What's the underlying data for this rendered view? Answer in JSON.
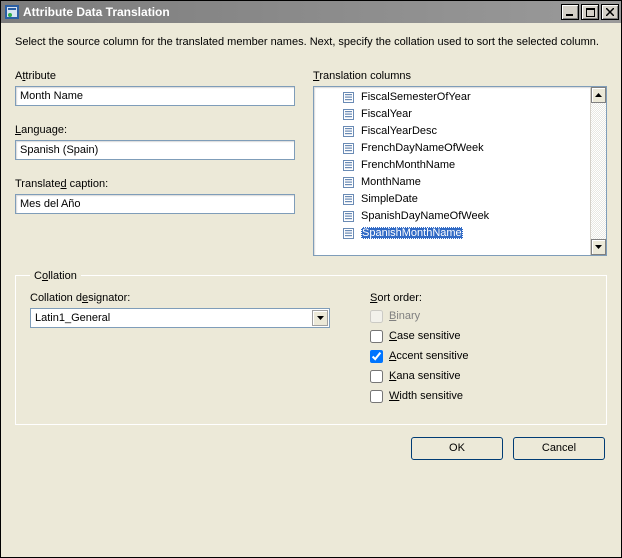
{
  "window": {
    "title": "Attribute Data Translation"
  },
  "description": "Select the source column for the translated member names.  Next, specify the collation used to sort the selected column.",
  "attribute": {
    "label_pre": "A",
    "label_u": "t",
    "label_post": "tribute",
    "value": "Month Name"
  },
  "language": {
    "label_pre": "",
    "label_u": "L",
    "label_post": "anguage:",
    "value": "Spanish (Spain)"
  },
  "translated_caption": {
    "label_pre": "Translate",
    "label_u": "d",
    "label_post": " caption:",
    "value": "Mes del Año"
  },
  "translation_columns": {
    "label_pre": "",
    "label_u": "T",
    "label_post": "ranslation columns",
    "items": [
      {
        "text": "FiscalSemesterOfYear",
        "selected": false
      },
      {
        "text": "FiscalYear",
        "selected": false
      },
      {
        "text": "FiscalYearDesc",
        "selected": false
      },
      {
        "text": "FrenchDayNameOfWeek",
        "selected": false
      },
      {
        "text": "FrenchMonthName",
        "selected": false
      },
      {
        "text": "MonthName",
        "selected": false
      },
      {
        "text": "SimpleDate",
        "selected": false
      },
      {
        "text": "SpanishDayNameOfWeek",
        "selected": false
      },
      {
        "text": "SpanishMonthName",
        "selected": true
      }
    ]
  },
  "collation": {
    "legend_pre": "C",
    "legend_u": "o",
    "legend_post": "llation",
    "designator": {
      "label_pre": "Collation d",
      "label_u": "e",
      "label_post": "signator:",
      "value": "Latin1_General"
    },
    "sortorder": {
      "label_pre": "",
      "label_u": "S",
      "label_post": "ort order:",
      "options": [
        {
          "pre": "",
          "u": "B",
          "post": "inary",
          "checked": false,
          "disabled": true
        },
        {
          "pre": "",
          "u": "C",
          "post": "ase sensitive",
          "checked": false,
          "disabled": false
        },
        {
          "pre": "",
          "u": "A",
          "post": "ccent sensitive",
          "checked": true,
          "disabled": false
        },
        {
          "pre": "",
          "u": "K",
          "post": "ana sensitive",
          "checked": false,
          "disabled": false
        },
        {
          "pre": "",
          "u": "W",
          "post": "idth sensitive",
          "checked": false,
          "disabled": false
        }
      ]
    }
  },
  "buttons": {
    "ok": "OK",
    "cancel": "Cancel"
  }
}
